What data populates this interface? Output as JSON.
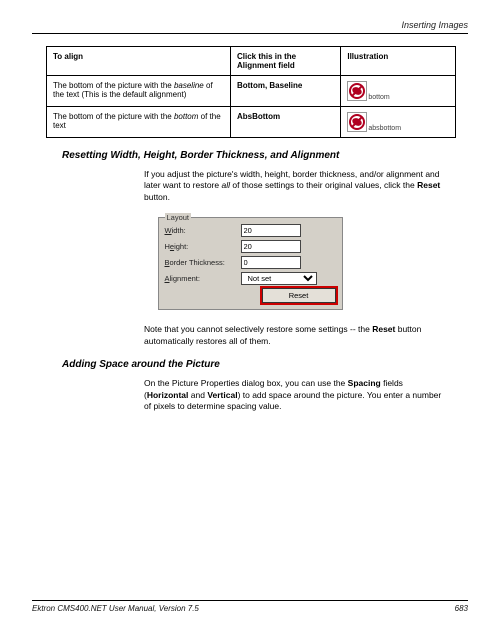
{
  "header": {
    "section": "Inserting Images"
  },
  "table": {
    "headers": {
      "col1": "To align",
      "col2": "Click this in the Alignment field",
      "col3": "Illustration"
    },
    "rows": [
      {
        "desc_pre": "The bottom of the picture with the ",
        "desc_italic": "baseline",
        "desc_post": " of the text (This is the default alignment)",
        "field": "Bottom, Baseline",
        "illus_label": "bottom"
      },
      {
        "desc_pre": "The bottom of the picture with the ",
        "desc_italic": "bottom",
        "desc_post": " of the text",
        "field": "AbsBottom",
        "illus_label": "absbottom"
      }
    ]
  },
  "section1": {
    "heading": "Resetting Width, Height, Border Thickness, and Alignment",
    "para1_pre": "If you adjust the picture's width, height, border thickness, and/or alignment and later want to restore ",
    "para1_italic": "all",
    "para1_mid": " of those settings to their original values, click the ",
    "para1_bold": "Reset",
    "para1_post": " button.",
    "para2_pre": "Note that you cannot selectively restore some settings -- the ",
    "para2_bold": "Reset",
    "para2_post": " button automatically restores all of them."
  },
  "dialog": {
    "legend": "Layout",
    "width_label_u": "W",
    "width_label_rest": "idth:",
    "width_value": "20",
    "height_label_pre": "H",
    "height_label_u": "e",
    "height_label_rest": "ight:",
    "height_value": "20",
    "border_label_u": "B",
    "border_label_rest": "order Thickness:",
    "border_value": "0",
    "align_label_u": "A",
    "align_label_rest": "lignment:",
    "align_value": "Not set",
    "reset_label": "Reset"
  },
  "section2": {
    "heading": "Adding Space around the Picture",
    "para_pre": "On the Picture Properties dialog box, you can use the ",
    "para_b1": "Spacing",
    "para_mid1": " fields (",
    "para_b2": "Horizontal",
    "para_mid2": " and ",
    "para_b3": "Vertical",
    "para_mid3": ") to add space around the picture. You enter a number of pixels to determine spacing value."
  },
  "footer": {
    "left": "Ektron CMS400.NET User Manual, Version 7.5",
    "right": "683"
  }
}
